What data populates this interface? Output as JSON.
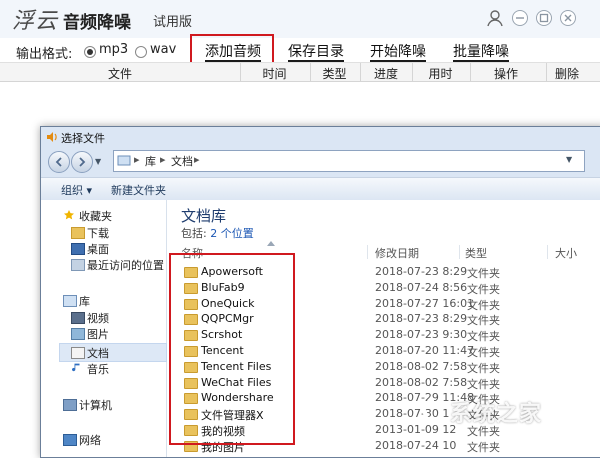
{
  "app": {
    "logo_text": "浮云",
    "name": "音频降噪",
    "edition": "试用版"
  },
  "toolbar": {
    "format_label": "输出格式:",
    "formats": [
      "mp3",
      "wav"
    ],
    "selected_format": "mp3",
    "add_audio": "添加音频",
    "save_dir": "保存目录",
    "start": "开始降噪",
    "batch": "批量降噪"
  },
  "table": {
    "headers": [
      "文件",
      "时间",
      "类型",
      "进度",
      "用时",
      "操作",
      "删除"
    ]
  },
  "dialog": {
    "title": "选择文件",
    "breadcrumb": [
      "库",
      "文档"
    ],
    "commands": {
      "organize": "组织 ▾",
      "new_folder": "新建文件夹"
    },
    "nav": {
      "favorites": "收藏夹",
      "downloads": "下载",
      "desktop": "桌面",
      "recent": "最近访问的位置",
      "libraries": "库",
      "videos": "视频",
      "pictures": "图片",
      "documents": "文档",
      "music": "音乐",
      "computer": "计算机",
      "network": "网络"
    },
    "library_title": "文档库",
    "library_includes": "包括:",
    "library_locations": "2 个位置",
    "columns": {
      "name": "名称",
      "modified": "修改日期",
      "type": "类型",
      "size": "大小"
    },
    "files": [
      {
        "name": "Apowersoft",
        "date": "2018-07-23 8:29",
        "type": "文件夹"
      },
      {
        "name": "BluFab9",
        "date": "2018-07-24 8:56",
        "type": "文件夹"
      },
      {
        "name": "OneQuick",
        "date": "2018-07-27 16:01",
        "type": "文件夹"
      },
      {
        "name": "QQPCMgr",
        "date": "2018-07-23 8:29",
        "type": "文件夹"
      },
      {
        "name": "Scrshot",
        "date": "2018-07-23 9:30",
        "type": "文件夹"
      },
      {
        "name": "Tencent",
        "date": "2018-07-20 11:47",
        "type": "文件夹"
      },
      {
        "name": "Tencent Files",
        "date": "2018-08-02 7:58",
        "type": "文件夹"
      },
      {
        "name": "WeChat Files",
        "date": "2018-08-02 7:58",
        "type": "文件夹"
      },
      {
        "name": "Wondershare",
        "date": "2018-07-29 11:48",
        "type": "文件夹"
      },
      {
        "name": "文件管理器X",
        "date": "2018-07-30 1",
        "type": "文件夹"
      },
      {
        "name": "我的视频",
        "date": "2013-01-09 12",
        "type": "文件夹"
      },
      {
        "name": "我的图片",
        "date": "2018-07-24 10",
        "type": "文件夹"
      }
    ]
  },
  "watermark": "系统之家"
}
